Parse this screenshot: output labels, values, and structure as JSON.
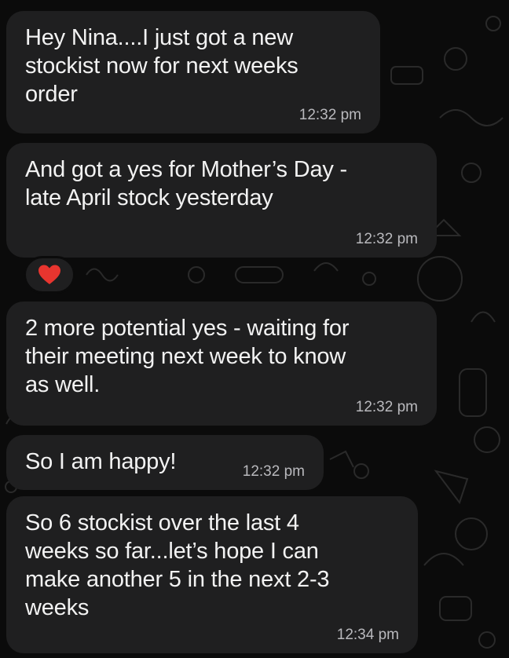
{
  "app": "Messaging chat",
  "colors": {
    "background": "#0b0b0b",
    "bubble": "#1f1f20",
    "text": "#f2f2f2",
    "timestamp": "#b9b9bd",
    "reaction_heart": "#e8352f"
  },
  "messages": [
    {
      "text": "Hey Nina....I just got a new\nstockist now for next weeks\norder",
      "time": "12:32 pm"
    },
    {
      "text": "And got a yes for Mother’s Day -\nlate April stock yesterday",
      "time": "12:32 pm",
      "reaction": {
        "icon": "red-heart-icon"
      }
    },
    {
      "text": "2 more potential yes - waiting for\ntheir meeting next week to know\nas well.",
      "time": "12:32 pm"
    },
    {
      "text": "So I am happy!",
      "time": "12:32 pm"
    },
    {
      "text": "So 6 stockist over the last 4\nweeks so far...let’s hope I can\nmake another 5 in the next 2-3\nweeks",
      "time": "12:34 pm"
    }
  ]
}
